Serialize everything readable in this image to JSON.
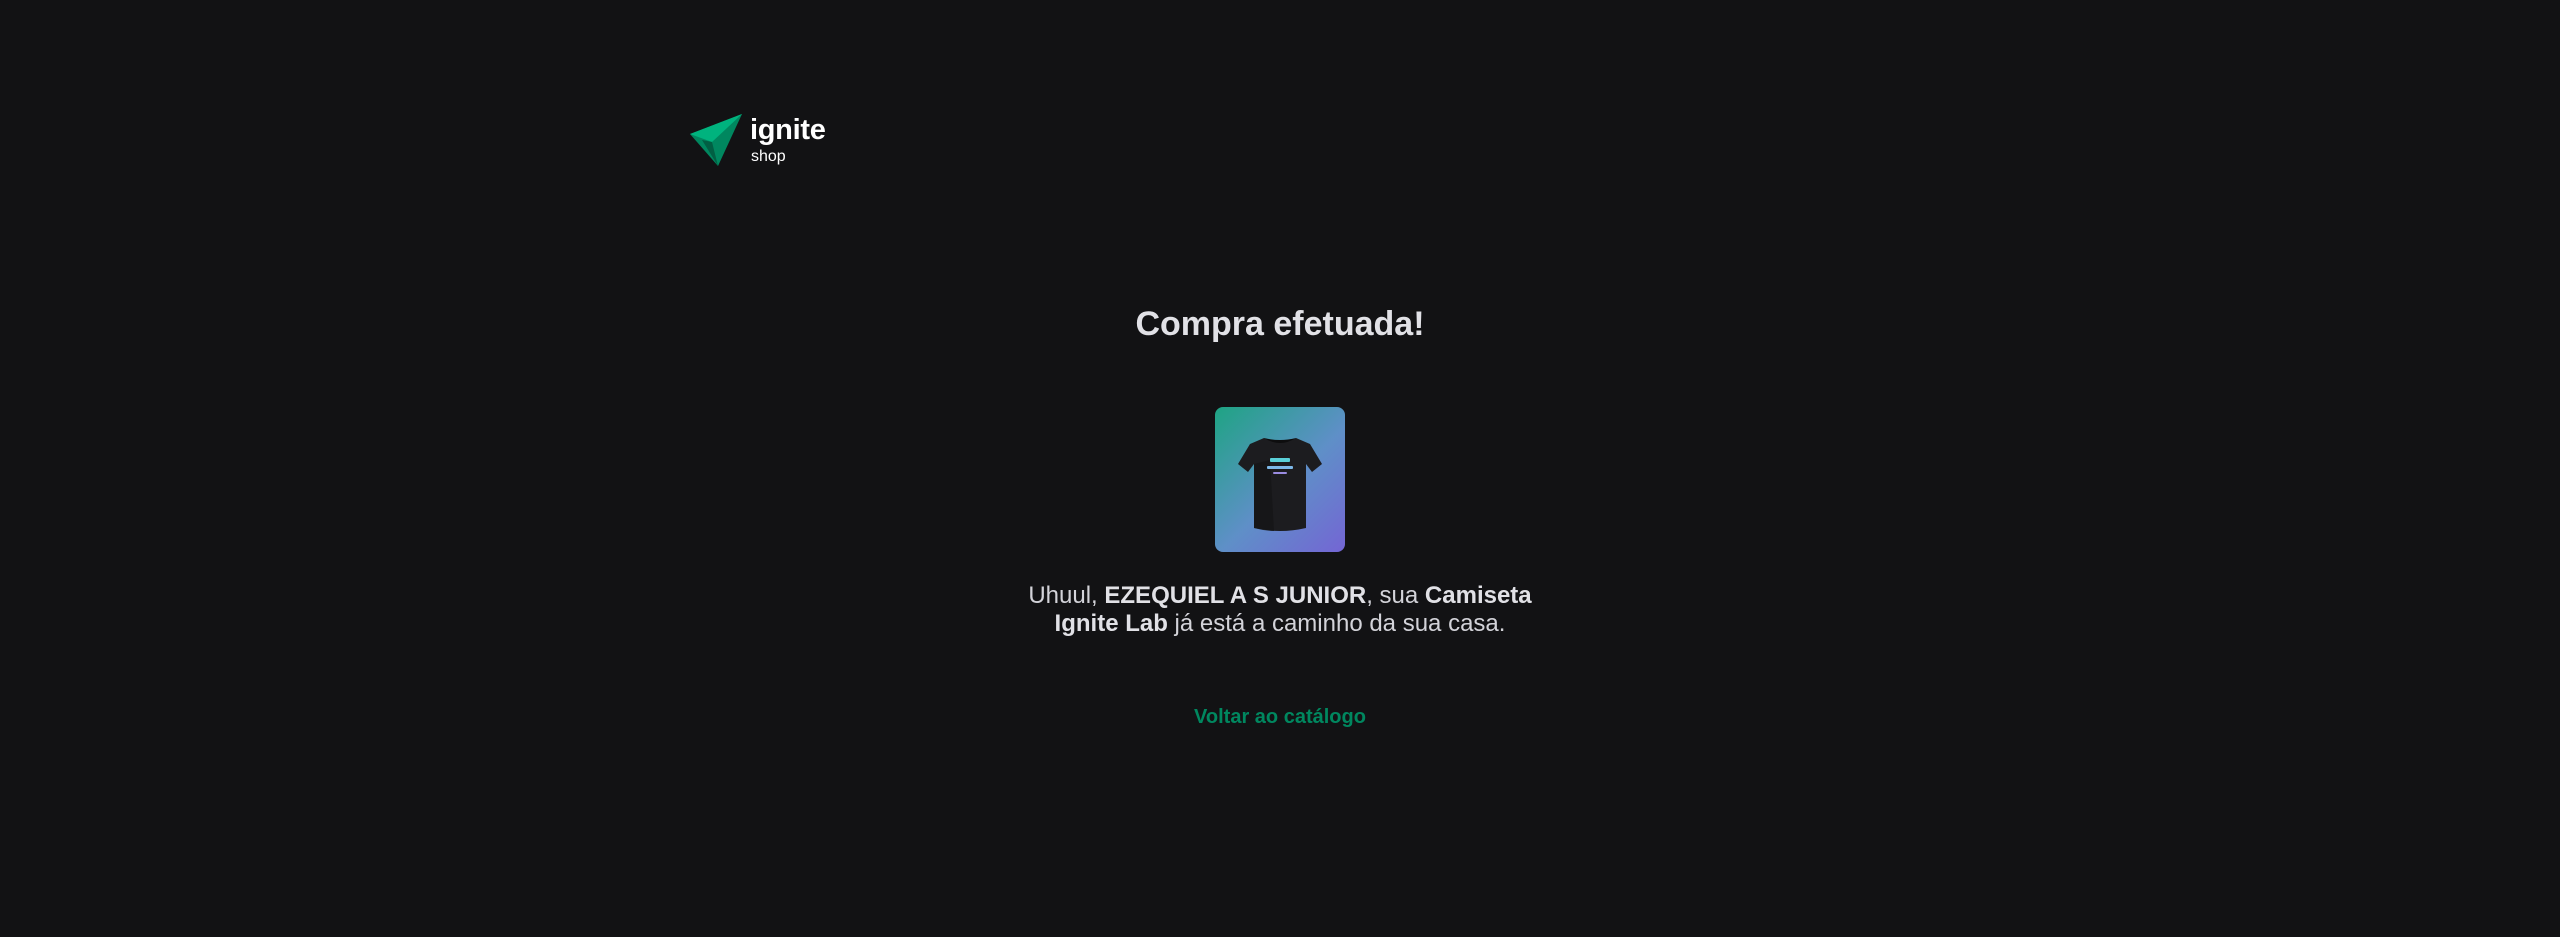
{
  "header": {
    "brand": "ignite",
    "sub": "shop"
  },
  "success": {
    "title": "Compra efetuada!",
    "message": {
      "greeting": "Uhuul, ",
      "customer_name": "EZEQUIEL A S JUNIOR",
      "middle": ", sua ",
      "product_name": "Camiseta Ignite Lab",
      "ending": " já está a caminho da sua casa."
    },
    "back_link": "Voltar ao catálogo"
  },
  "colors": {
    "background": "#121214",
    "brand_green": "#00875f",
    "title": "#e1e1e6",
    "text": "#c4c4cc",
    "gradient_start": "#1ea483",
    "gradient_end": "#7465d4"
  },
  "icons": {
    "logo": "ignite-arrow-logo",
    "product": "tshirt-icon"
  }
}
